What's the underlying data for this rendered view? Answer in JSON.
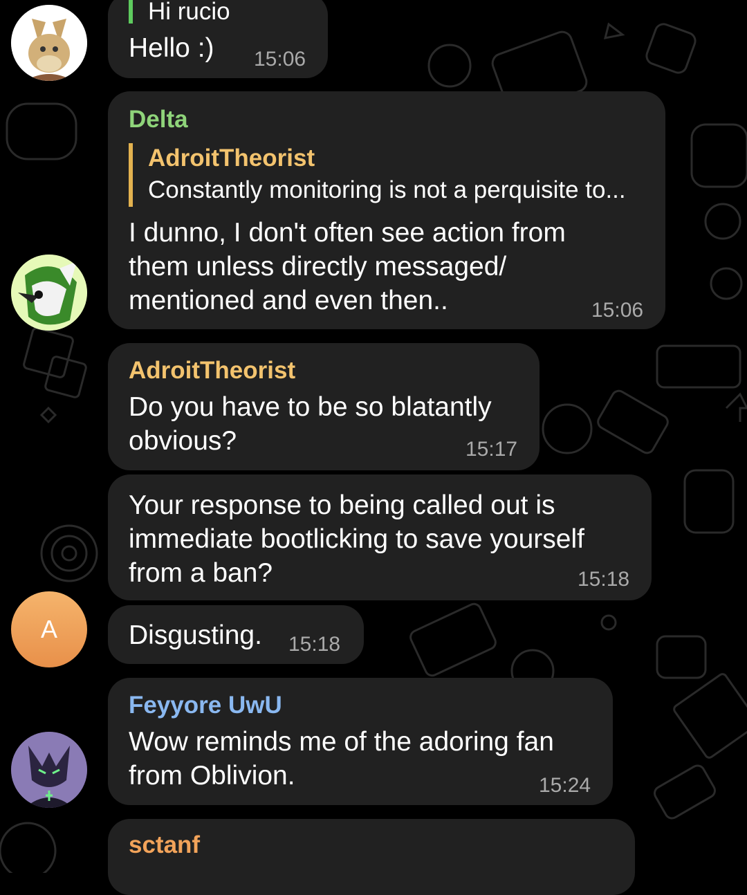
{
  "colors": {
    "background": "#000000",
    "bubble": "#212121",
    "name_green": "#8fd47a",
    "name_yellow": "#f3c36e",
    "name_blue": "#8ab8f0",
    "name_orange": "#f2a35a",
    "time": "#aaaaaa",
    "quote_yellow": "#e3b24f"
  },
  "messages": [
    {
      "reply": {
        "text": "Hi rucio"
      },
      "text": [
        "Hello :)"
      ],
      "time": "15:06"
    },
    {
      "sender": "Delta",
      "reply": {
        "author": "AdroitTheorist",
        "text": "Constantly monitoring is not a perquisite to..."
      },
      "text": [
        "I dunno, I don't often see action from",
        "them unless directly messaged/",
        "mentioned and even then.."
      ],
      "time": "15:06"
    },
    {
      "sender": "AdroitTheorist",
      "text": [
        "Do you have to be so blatantly",
        "obvious?"
      ],
      "time": "15:17"
    },
    {
      "text": [
        "Your response to being called out is",
        "immediate bootlicking to save yourself",
        "from a ban?"
      ],
      "time": "15:18"
    },
    {
      "text": [
        "Disgusting."
      ],
      "time": "15:18",
      "avatar_letter": "A"
    },
    {
      "sender": "Feyyore UwU",
      "text": [
        "Wow reminds me of the adoring fan",
        "from Oblivion."
      ],
      "time": "15:24"
    },
    {
      "sender": "sctanf"
    }
  ],
  "avatars": [
    "donkey-avatar",
    "green-wolf-avatar",
    "letter-avatar",
    "purple-fox-avatar"
  ]
}
